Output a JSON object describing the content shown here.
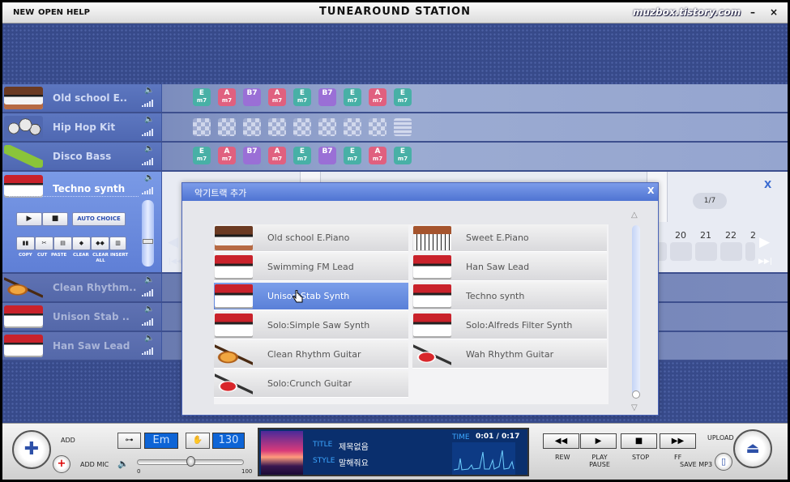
{
  "app": {
    "title": "TUNEAROUND STATION",
    "watermark": "muzbox.tistory.com",
    "menu": [
      "NEW",
      "OPEN",
      "HELP"
    ],
    "minimize": "–",
    "close": "×"
  },
  "tracks": [
    {
      "name": "Old school E..",
      "icon": "piano-icon",
      "content": "chords"
    },
    {
      "name": "Hip Hop Kit",
      "icon": "drum-kit-icon",
      "content": "pattern"
    },
    {
      "name": "Disco Bass",
      "icon": "bass-guitar-icon",
      "content": "chords"
    },
    {
      "name": "Techno synth",
      "icon": "synth-icon",
      "content": "selected"
    },
    {
      "name": "Clean Rhythm..",
      "icon": "guitar-icon",
      "content": "empty"
    },
    {
      "name": "Unison Stab ..",
      "icon": "synth-icon",
      "content": "empty"
    },
    {
      "name": "Han Saw Lead",
      "icon": "synth-icon",
      "content": "empty"
    }
  ],
  "chords": [
    {
      "root": "E",
      "q": "m7",
      "color": "#48b0a6"
    },
    {
      "root": "A",
      "q": "m7",
      "color": "#e0607f"
    },
    {
      "root": "B7",
      "q": "",
      "color": "#9a6fd6"
    },
    {
      "root": "A",
      "q": "m7",
      "color": "#e0607f"
    },
    {
      "root": "E",
      "q": "m7",
      "color": "#48b0a6"
    },
    {
      "root": "B7",
      "q": "",
      "color": "#9a6fd6"
    },
    {
      "root": "E",
      "q": "m7",
      "color": "#48b0a6"
    },
    {
      "root": "A",
      "q": "m7",
      "color": "#e0607f"
    },
    {
      "root": "E",
      "q": "m7",
      "color": "#48b0a6"
    }
  ],
  "track_controls": {
    "auto_choice": "AUTO CHOICE",
    "edit_labels": [
      "COPY",
      "CUT",
      "PASTE",
      "CLEAR",
      "CLEAR ALL",
      "INSERT"
    ]
  },
  "lane": {
    "page": "1/7",
    "close": "X",
    "beats": [
      "20",
      "21",
      "22",
      "2"
    ]
  },
  "dialog": {
    "title": "악기트랙 추가",
    "close": "X",
    "instruments": [
      {
        "label": "Old school E.Piano",
        "img": "piano"
      },
      {
        "label": "Sweet E.Piano",
        "img": "piano2"
      },
      {
        "label": "Swimming FM Lead",
        "img": "synth"
      },
      {
        "label": "Han Saw Lead",
        "img": "synth"
      },
      {
        "label": "Unison Stab Synth",
        "img": "synth",
        "selected": true
      },
      {
        "label": "Techno synth",
        "img": "synth"
      },
      {
        "label": "Solo:Simple Saw Synth",
        "img": "synth"
      },
      {
        "label": "Solo:Alfreds Filter Synth",
        "img": "synth"
      },
      {
        "label": "Clean Rhythm Guitar",
        "img": "oguitar"
      },
      {
        "label": "Wah Rhythm Guitar",
        "img": "rguitar"
      },
      {
        "label": "Solo:Crunch Guitar",
        "img": "rguitar"
      }
    ]
  },
  "bottom": {
    "add": "ADD",
    "add_mic": "ADD MIC",
    "key_value": "Em",
    "tempo_value": "130",
    "vol_min": "0",
    "vol_max": "100",
    "volume": 0.5,
    "title_label": "TITLE",
    "title_value": "제목없음",
    "style_label": "STYLE",
    "style_value": "말해줘요",
    "time_label": "TIME",
    "time_value": "0:01 / 0:17",
    "transport": [
      {
        "label": "REW",
        "glyph": "◀◀"
      },
      {
        "label": "PLAY PAUSE",
        "glyph": "▶"
      },
      {
        "label": "STOP",
        "glyph": "■"
      },
      {
        "label": "FF",
        "glyph": "▶▶"
      }
    ],
    "upload": "UPLOAD",
    "save_mp3": "SAVE MP3"
  },
  "colors": {
    "accent": "#5a80d8",
    "display": "#0a2f6d",
    "value_box": "#0d64d6"
  }
}
